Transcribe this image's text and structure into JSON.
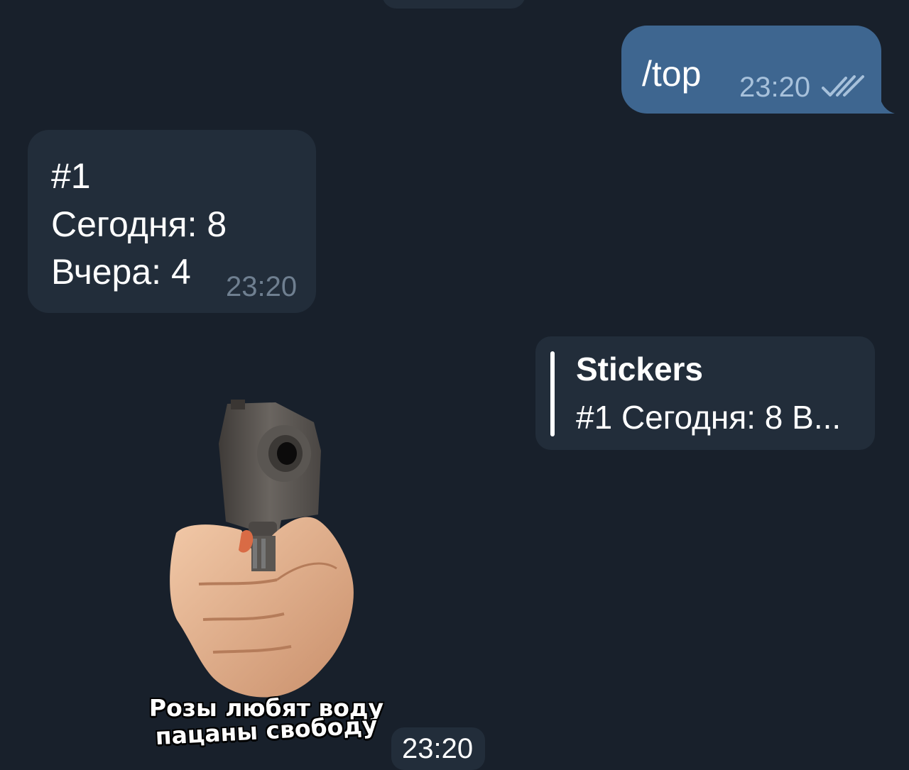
{
  "messages": {
    "outgoing": {
      "text": "/top",
      "time": "23:20",
      "status_icon": "double-check-icon"
    },
    "incoming": {
      "line1": "#1",
      "line2": "Сегодня: 8",
      "line3": "Вчера: 4",
      "time": "23:20"
    },
    "reply_preview": {
      "title": "Stickers",
      "snippet": "#1 Сегодня: 8 В..."
    },
    "sticker": {
      "icon": "pistol-hand-sticker",
      "caption_line1": "Розы любят воду",
      "caption_line2": "пацаны свободу",
      "time": "23:20"
    }
  },
  "colors": {
    "background": "#18202b",
    "incoming_bubble": "#222d3a",
    "outgoing_bubble": "#3e6690",
    "outgoing_meta": "#a7c1db",
    "incoming_meta": "#6f7f90"
  }
}
